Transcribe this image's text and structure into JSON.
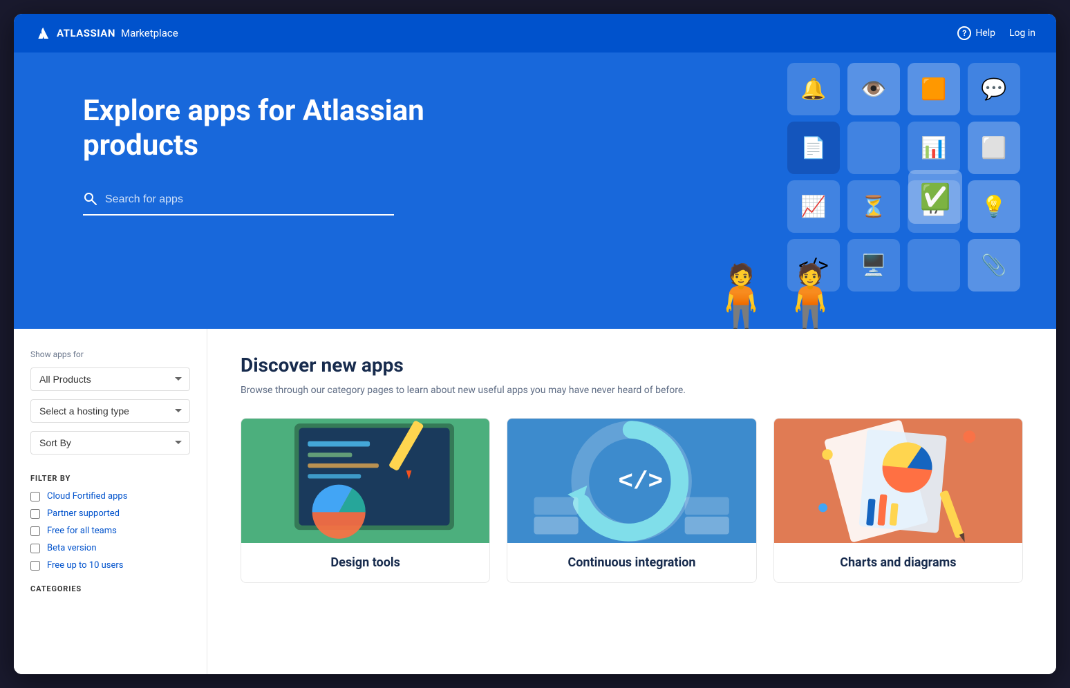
{
  "nav": {
    "brand_atlassian": "ATLASSIAN",
    "brand_marketplace": "Marketplace",
    "help_label": "Help",
    "login_label": "Log in"
  },
  "hero": {
    "title_line1": "Explore apps for Atlassian",
    "title_line2": "products",
    "search_placeholder": "Search for apps"
  },
  "sidebar": {
    "show_apps_label": "Show apps for",
    "all_products_option": "All Products",
    "hosting_placeholder": "Select a hosting type",
    "sort_label": "Sort By",
    "filter_by_label": "FILTER BY",
    "filters": [
      {
        "label": "Cloud Fortified apps"
      },
      {
        "label": "Partner supported"
      },
      {
        "label": "Free for all teams"
      },
      {
        "label": "Beta version"
      },
      {
        "label": "Free up to 10 users"
      }
    ],
    "categories_label": "CATEGORIES"
  },
  "content": {
    "discover_title": "Discover new apps",
    "discover_subtitle": "Browse through our category pages to learn about new useful apps you may have never heard of before.",
    "cards": [
      {
        "label": "Design tools",
        "color": "green",
        "id": "design-tools"
      },
      {
        "label": "Continuous integration",
        "color": "blue",
        "id": "continuous-integration"
      },
      {
        "label": "Charts and diagrams",
        "color": "orange",
        "id": "charts-diagrams"
      }
    ]
  }
}
